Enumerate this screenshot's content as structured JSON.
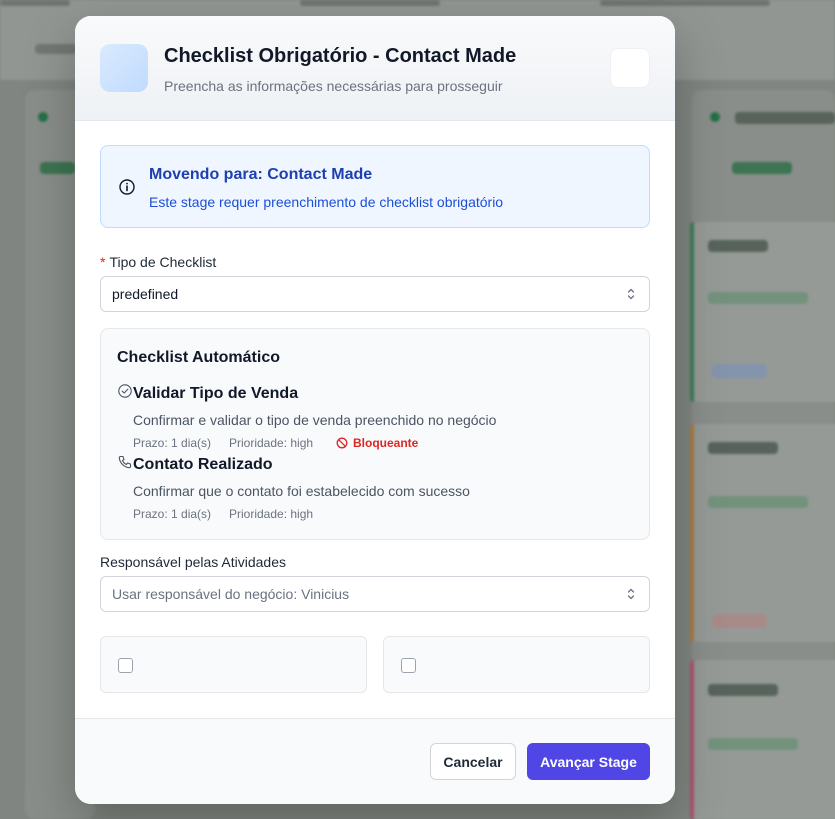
{
  "modal": {
    "title": "Checklist Obrigatório - Contact Made",
    "subtitle": "Preencha as informações necessárias para prosseguir"
  },
  "info": {
    "title": "Movendo para: Contact Made",
    "text": "Este stage requer preenchimento de checklist obrigatório"
  },
  "checklist_type": {
    "required_mark": "*",
    "label": "Tipo de Checklist",
    "value": "predefined"
  },
  "auto_checklist": {
    "title": "Checklist Automático",
    "items": [
      {
        "icon": "check-circle-icon",
        "title": "Validar Tipo de Venda",
        "description": "Confirmar e validar o tipo de venda preenchido no negócio",
        "deadline": "Prazo: 1 dia(s)",
        "priority": "Prioridade: high",
        "blocking": "Bloqueante"
      },
      {
        "icon": "phone-icon",
        "title": "Contato Realizado",
        "description": "Confirmar que o contato foi estabelecido com sucesso",
        "deadline": "Prazo: 1 dia(s)",
        "priority": "Prioridade: high"
      }
    ]
  },
  "responsible": {
    "label": "Responsável pelas Atividades",
    "placeholder": "Usar responsável do negócio: Vinicius"
  },
  "footer": {
    "cancel_label": "Cancelar",
    "advance_label": "Avançar Stage"
  },
  "colors": {
    "primary": "#4f46e5",
    "info_bg": "#eff6ff",
    "info_text": "#1e40af",
    "danger": "#dc2626"
  }
}
